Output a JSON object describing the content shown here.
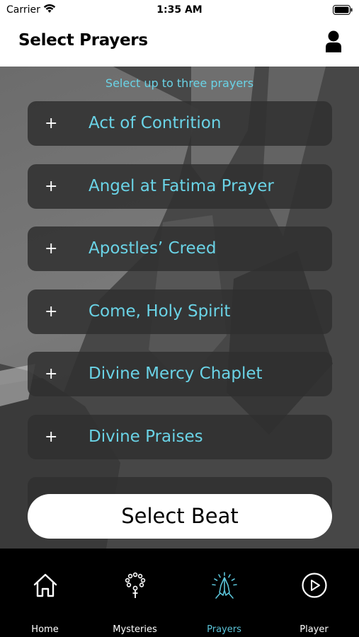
{
  "status_bar": {
    "carrier": "Carrier",
    "time": "1:35 AM"
  },
  "header": {
    "title": "Select Prayers",
    "profile_icon": "person-icon"
  },
  "hint": "Select up to three prayers",
  "prayers": [
    {
      "label": "Act of Contrition"
    },
    {
      "label": "Angel at Fatima Prayer"
    },
    {
      "label": "Apostles’ Creed"
    },
    {
      "label": "Come, Holy Spirit"
    },
    {
      "label": "Divine Mercy Chaplet"
    },
    {
      "label": "Divine Praises"
    }
  ],
  "plus_symbol": "+",
  "select_beat_label": "Select Beat",
  "tabs": [
    {
      "label": "Home",
      "icon": "home-icon"
    },
    {
      "label": "Mysteries",
      "icon": "rosary-icon"
    },
    {
      "label": "Prayers",
      "icon": "praying-hands-icon",
      "active": true
    },
    {
      "label": "Player",
      "icon": "play-circle-icon"
    }
  ],
  "colors": {
    "accent": "#6ad3e6",
    "tab_active": "#5bc3d8",
    "item_bg": "#303030",
    "tab_bar": "#000000"
  }
}
